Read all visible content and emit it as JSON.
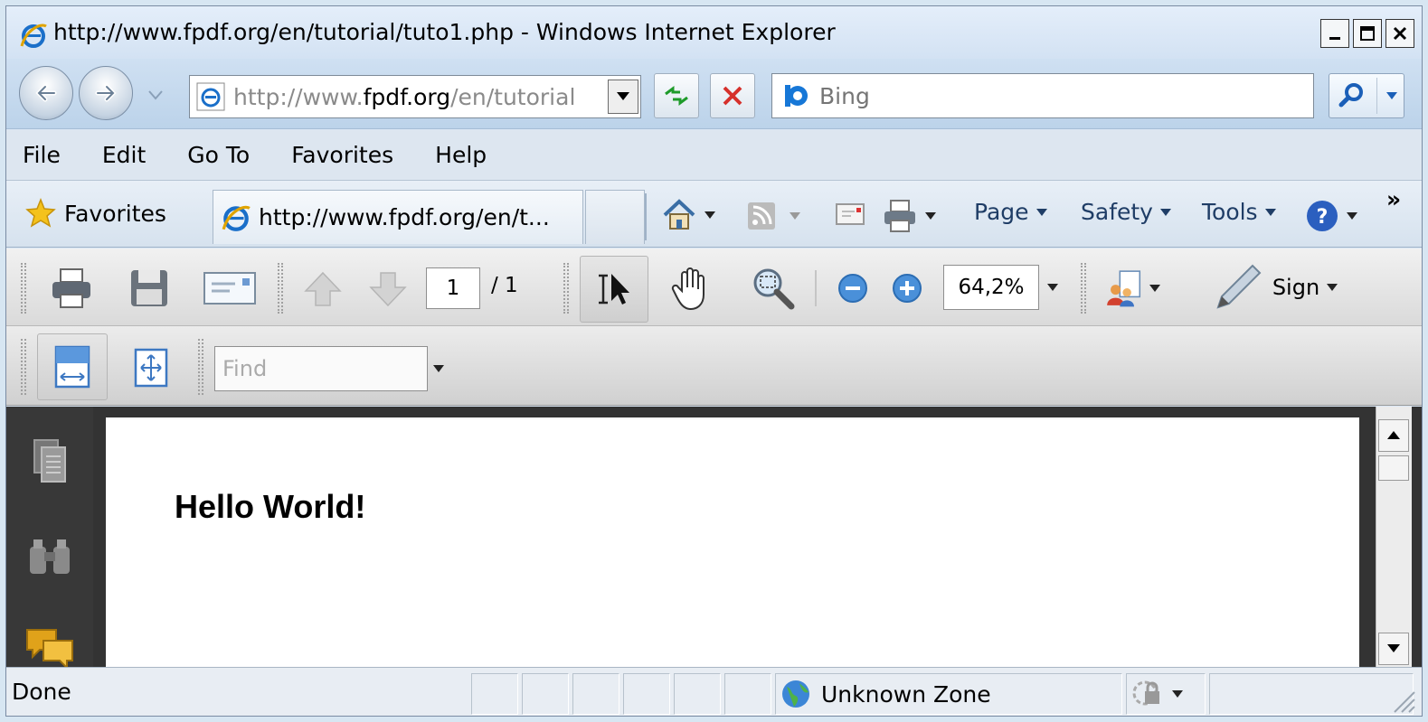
{
  "window": {
    "title": "http://www.fpdf.org/en/tutorial/tuto1.php - Windows Internet Explorer"
  },
  "address": {
    "prefix": "http://www.",
    "domain": "fpdf.org",
    "suffix": "/en/tutorial"
  },
  "search": {
    "placeholder": "Bing"
  },
  "menu": {
    "items": [
      "File",
      "Edit",
      "Go To",
      "Favorites",
      "Help"
    ]
  },
  "commandbar": {
    "favorites_label": "Favorites",
    "tab_title": "http://www.fpdf.org/en/t...",
    "page_label": "Page",
    "safety_label": "Safety",
    "tools_label": "Tools",
    "overflow_label": "»"
  },
  "pdf_toolbar": {
    "current_page": "1",
    "page_total": "/ 1",
    "zoom": "64,2%",
    "sign_label": "Sign",
    "find_placeholder": "Find"
  },
  "document": {
    "text": "Hello World!"
  },
  "status": {
    "text": "Done",
    "zone": "Unknown Zone"
  }
}
